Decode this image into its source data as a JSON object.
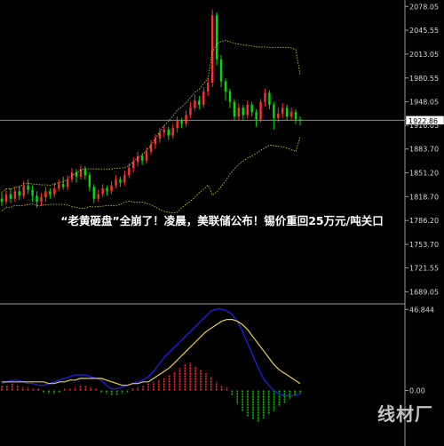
{
  "headline": "“老黄砸盘”全崩了！凌晨，美联储公布！锡价重回25万元/吨关口",
  "watermark": "线材厂",
  "colors": {
    "background": "#000000",
    "up": "#ff3030",
    "down": "#00e000",
    "band": "#d8d820",
    "price_line": "#8a8a8a",
    "price_box": "#ffffff",
    "macd_fast": "#2020ff",
    "macd_slow": "#e8d040",
    "hist_up": "#ff3030",
    "hist_down": "#00c800",
    "axis_text": "#d8d8d8"
  },
  "chart_data": [
    {
      "type": "candlestick",
      "yticks": [
        "2078.05",
        "2045.55",
        "2013.05",
        "1980.55",
        "1948.05",
        "1916.05",
        "1883.70",
        "1851.20",
        "1818.70",
        "1786.20",
        "1753.70",
        "1721.55",
        "1689.05"
      ],
      "ylim": [
        1675,
        2082
      ],
      "last_price": "1922.86",
      "candles": [
        [
          1816,
          1812,
          1824,
          1806
        ],
        [
          1812,
          1822,
          1828,
          1808
        ],
        [
          1822,
          1816,
          1830,
          1810
        ],
        [
          1816,
          1826,
          1832,
          1812
        ],
        [
          1826,
          1820,
          1834,
          1814
        ],
        [
          1820,
          1834,
          1840,
          1816
        ],
        [
          1834,
          1828,
          1842,
          1822
        ],
        [
          1828,
          1820,
          1834,
          1812
        ],
        [
          1820,
          1812,
          1826,
          1804
        ],
        [
          1812,
          1818,
          1824,
          1806
        ],
        [
          1818,
          1826,
          1832,
          1812
        ],
        [
          1826,
          1822,
          1830,
          1816
        ],
        [
          1822,
          1830,
          1838,
          1818
        ],
        [
          1830,
          1836,
          1842,
          1826
        ],
        [
          1836,
          1832,
          1846,
          1828
        ],
        [
          1832,
          1842,
          1848,
          1828
        ],
        [
          1842,
          1852,
          1858,
          1838
        ],
        [
          1852,
          1846,
          1856,
          1838
        ],
        [
          1846,
          1856,
          1862,
          1842
        ],
        [
          1856,
          1848,
          1860,
          1842
        ],
        [
          1848,
          1832,
          1852,
          1826
        ],
        [
          1832,
          1816,
          1836,
          1810
        ],
        [
          1816,
          1822,
          1828,
          1812
        ],
        [
          1822,
          1830,
          1836,
          1818
        ],
        [
          1830,
          1826,
          1834,
          1820
        ],
        [
          1826,
          1834,
          1840,
          1822
        ],
        [
          1834,
          1842,
          1848,
          1830
        ],
        [
          1842,
          1838,
          1846,
          1832
        ],
        [
          1838,
          1848,
          1854,
          1834
        ],
        [
          1848,
          1858,
          1864,
          1844
        ],
        [
          1858,
          1866,
          1872,
          1852
        ],
        [
          1866,
          1874,
          1880,
          1860
        ],
        [
          1874,
          1868,
          1878,
          1862
        ],
        [
          1868,
          1880,
          1886,
          1864
        ],
        [
          1880,
          1890,
          1896,
          1876
        ],
        [
          1890,
          1898,
          1904,
          1884
        ],
        [
          1898,
          1906,
          1912,
          1892
        ],
        [
          1906,
          1910,
          1916,
          1900
        ],
        [
          1910,
          1902,
          1914,
          1896
        ],
        [
          1902,
          1912,
          1918,
          1898
        ],
        [
          1912,
          1922,
          1928,
          1906
        ],
        [
          1922,
          1918,
          1926,
          1912
        ],
        [
          1918,
          1930,
          1936,
          1914
        ],
        [
          1930,
          1940,
          1948,
          1926
        ],
        [
          1940,
          1950,
          1958,
          1936
        ],
        [
          1950,
          1944,
          1956,
          1938
        ],
        [
          1944,
          1962,
          1968,
          1940
        ],
        [
          1962,
          1974,
          1980,
          1956
        ],
        [
          1974,
          2066,
          2074,
          1968
        ],
        [
          2066,
          2006,
          2070,
          1998
        ],
        [
          2006,
          1976,
          2012,
          1968
        ],
        [
          1976,
          1962,
          1980,
          1950
        ],
        [
          1962,
          1948,
          1966,
          1940
        ],
        [
          1948,
          1928,
          1952,
          1922
        ],
        [
          1928,
          1940,
          1946,
          1922
        ],
        [
          1940,
          1930,
          1944,
          1924
        ],
        [
          1930,
          1944,
          1950,
          1926
        ],
        [
          1944,
          1934,
          1948,
          1928
        ],
        [
          1934,
          1924,
          1938,
          1914
        ],
        [
          1924,
          1948,
          1952,
          1920
        ],
        [
          1948,
          1960,
          1966,
          1942
        ],
        [
          1960,
          1944,
          1964,
          1938
        ],
        [
          1944,
          1926,
          1948,
          1910
        ],
        [
          1926,
          1932,
          1940,
          1920
        ],
        [
          1932,
          1940,
          1946,
          1926
        ],
        [
          1940,
          1928,
          1944,
          1922
        ],
        [
          1928,
          1934,
          1940,
          1924
        ],
        [
          1934,
          1924,
          1938,
          1918
        ],
        [
          1924,
          1922,
          1928,
          1916
        ]
      ]
    },
    {
      "type": "macd",
      "yticks": [
        "46.844",
        "0.00"
      ],
      "ylim": [
        -30,
        48
      ],
      "fast": [
        4,
        5,
        6,
        6,
        5,
        4,
        4,
        3,
        3,
        4,
        5,
        6,
        7,
        8,
        9,
        9,
        9,
        8,
        7,
        6,
        3,
        1,
        1,
        2,
        3,
        4,
        5,
        6,
        8,
        11,
        15,
        19,
        22,
        25,
        28,
        31,
        34,
        37,
        40,
        43,
        46,
        47,
        47,
        46,
        44,
        40,
        34,
        27,
        20,
        13,
        7,
        3,
        0,
        -2,
        -3,
        -3,
        -3,
        -2
      ],
      "slow": [
        5,
        5,
        5,
        5,
        5,
        5,
        5,
        5,
        5,
        4,
        4,
        5,
        5,
        6,
        6,
        7,
        7,
        7,
        7,
        7,
        6,
        5,
        4,
        3,
        3,
        4,
        4,
        5,
        5,
        7,
        9,
        11,
        13,
        16,
        19,
        22,
        25,
        28,
        31,
        34,
        36,
        38,
        40,
        41,
        41,
        40,
        38,
        35,
        31,
        27,
        23,
        19,
        15,
        12,
        10,
        8,
        6,
        4
      ],
      "hist": [
        3,
        3,
        4,
        3,
        2,
        2,
        1,
        1,
        -1,
        -2,
        -2,
        -1,
        1,
        1,
        2,
        3,
        3,
        2,
        1,
        -1,
        -2,
        -3,
        -3,
        -2,
        -1,
        1,
        2,
        3,
        4,
        5,
        6,
        7,
        9,
        11,
        13,
        15,
        16,
        14,
        12,
        10,
        8,
        5,
        3,
        2,
        -3,
        -8,
        -12,
        -15,
        -17,
        -18,
        -16,
        -14,
        -12,
        -9,
        -7,
        -5,
        -3,
        -2
      ]
    }
  ]
}
